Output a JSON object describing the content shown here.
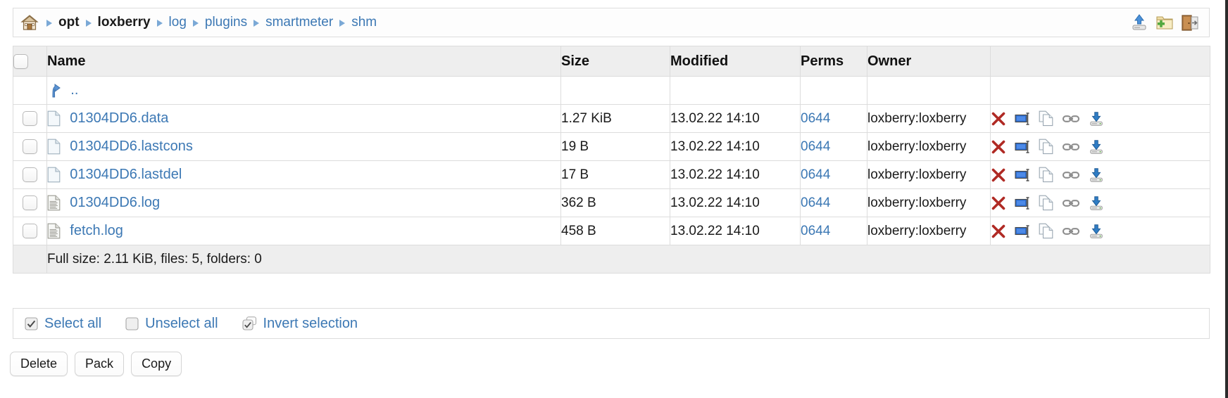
{
  "breadcrumb": {
    "home_icon": "home-icon",
    "separator_icon": "triangle-right-icon",
    "items": [
      {
        "label": "opt",
        "kind": "text"
      },
      {
        "label": "loxberry",
        "kind": "text"
      },
      {
        "label": "log",
        "kind": "link"
      },
      {
        "label": "plugins",
        "kind": "link"
      },
      {
        "label": "smartmeter",
        "kind": "link"
      },
      {
        "label": "shm",
        "kind": "link"
      }
    ],
    "tools": [
      {
        "name": "upload-icon",
        "title": "Upload"
      },
      {
        "name": "new-folder-icon",
        "title": "New folder"
      },
      {
        "name": "logout-icon",
        "title": "Logout"
      }
    ]
  },
  "table": {
    "headers": {
      "select": "",
      "name": "Name",
      "size": "Size",
      "modified": "Modified",
      "perms": "Perms",
      "owner": "Owner",
      "actions": ""
    },
    "parent_row": {
      "icon": "arrow-up-curved-icon",
      "label": ".."
    },
    "rows": [
      {
        "icon": "file-blank-icon",
        "name": "01304DD6.data",
        "size": "1.27 KiB",
        "modified": "13.02.22 14:10",
        "perms": "0644",
        "owner": "loxberry:loxberry"
      },
      {
        "icon": "file-blank-icon",
        "name": "01304DD6.lastcons",
        "size": "19 B",
        "modified": "13.02.22 14:10",
        "perms": "0644",
        "owner": "loxberry:loxberry"
      },
      {
        "icon": "file-blank-icon",
        "name": "01304DD6.lastdel",
        "size": "17 B",
        "modified": "13.02.22 14:10",
        "perms": "0644",
        "owner": "loxberry:loxberry"
      },
      {
        "icon": "file-text-icon",
        "name": "01304DD6.log",
        "size": "362 B",
        "modified": "13.02.22 14:10",
        "perms": "0644",
        "owner": "loxberry:loxberry"
      },
      {
        "icon": "file-text-icon",
        "name": "fetch.log",
        "size": "458 B",
        "modified": "13.02.22 14:10",
        "perms": "0644",
        "owner": "loxberry:loxberry"
      }
    ],
    "row_actions": [
      {
        "name": "delete-icon",
        "title": "Delete"
      },
      {
        "name": "rename-icon",
        "title": "Rename"
      },
      {
        "name": "copy-icon",
        "title": "Copy"
      },
      {
        "name": "link-icon",
        "title": "Direct link"
      },
      {
        "name": "download-icon",
        "title": "Download"
      }
    ],
    "summary": "Full size: 2.11 KiB, files: 5, folders: 0"
  },
  "selection_bar": {
    "select_all": {
      "label": "Select all",
      "icon": "checkbox-checked-icon"
    },
    "unselect_all": {
      "label": "Unselect all",
      "icon": "checkbox-empty-icon"
    },
    "invert_selection": {
      "label": "Invert selection",
      "icon": "checkbox-invert-icon"
    }
  },
  "buttons": [
    {
      "label": "Delete",
      "name": "delete-button"
    },
    {
      "label": "Pack",
      "name": "pack-button"
    },
    {
      "label": "Copy",
      "name": "copy-button"
    }
  ],
  "colors": {
    "link": "#3c78b4",
    "header_bg": "#eeeeee",
    "border": "#dcdcdc",
    "text": "#1a1a1a",
    "muted": "#6d6d6d",
    "danger": "#b02a24"
  }
}
